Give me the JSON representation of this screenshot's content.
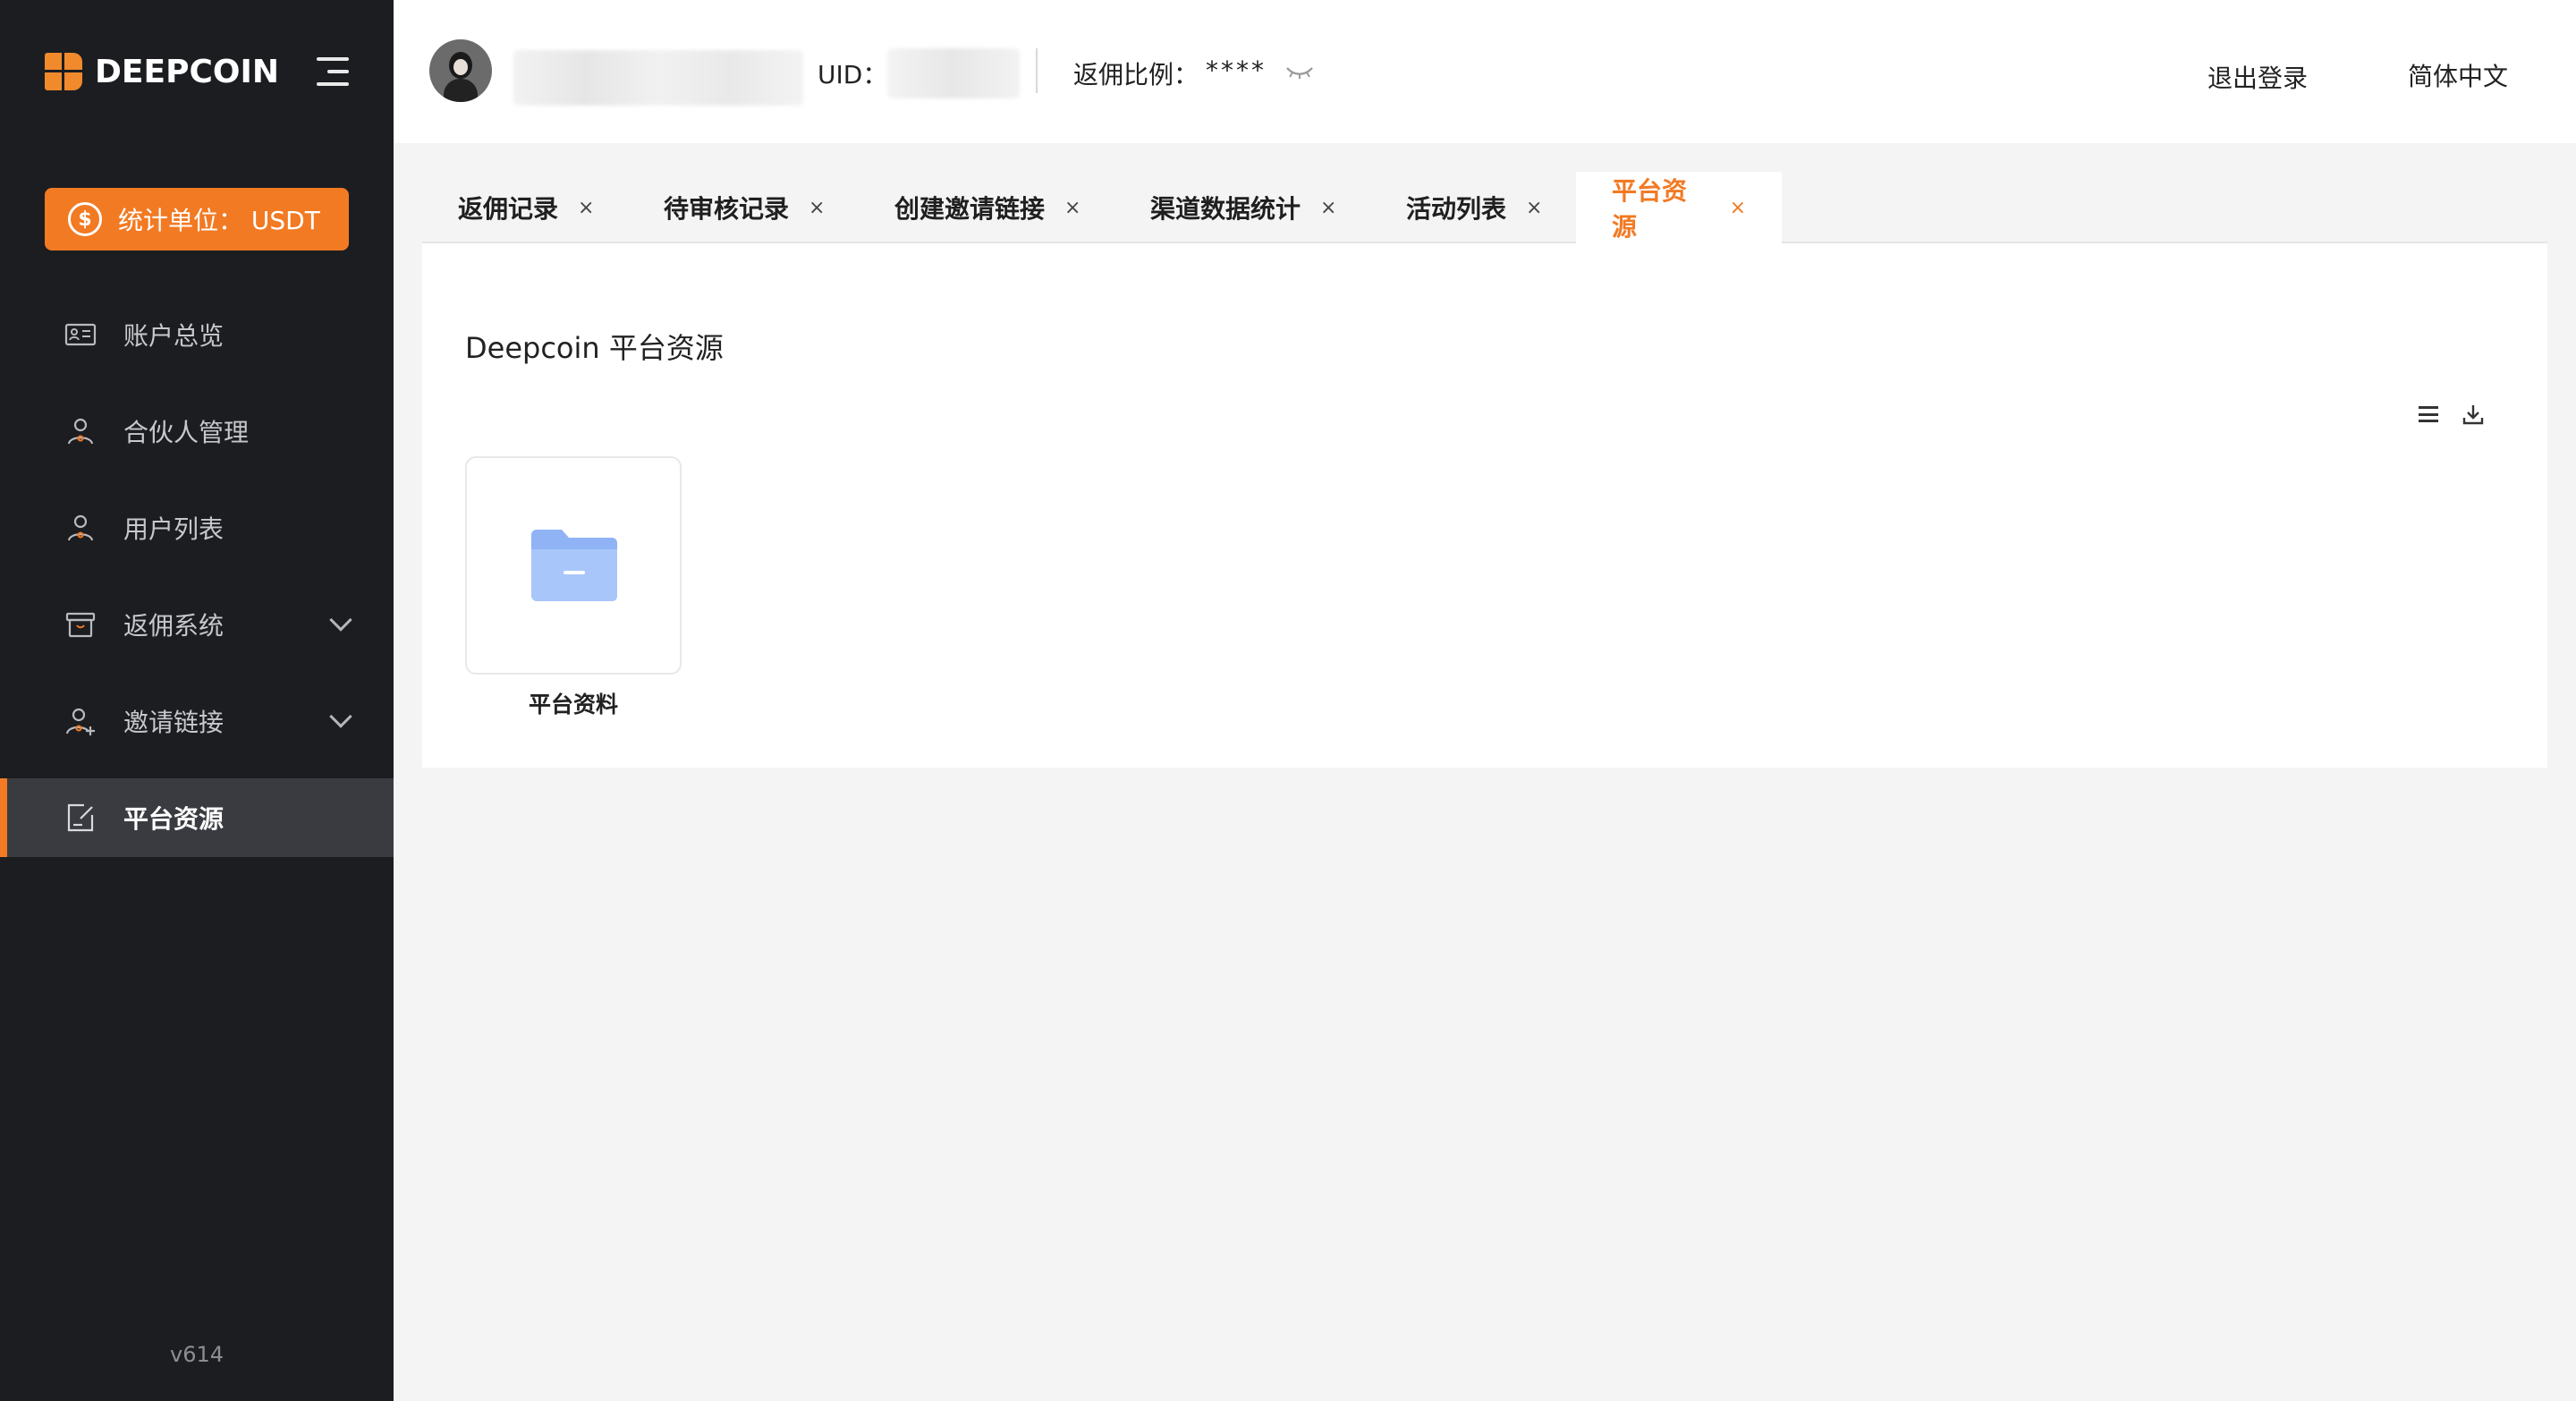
{
  "brand": {
    "name": "DEEPCOIN",
    "accent": "#f27a23"
  },
  "sidebar": {
    "unit_button": "统计单位：  USDT",
    "items": [
      {
        "label": "账户总览",
        "icon": "id-card-icon"
      },
      {
        "label": "合伙人管理",
        "icon": "partner-icon"
      },
      {
        "label": "用户列表",
        "icon": "user-icon"
      },
      {
        "label": "返佣系统",
        "icon": "gift-box-icon",
        "has_submenu": true
      },
      {
        "label": "邀请链接",
        "icon": "user-add-icon",
        "has_submenu": true
      },
      {
        "label": "平台资源",
        "icon": "edit-doc-icon",
        "active": true
      }
    ],
    "version": "v614"
  },
  "header": {
    "uid_label": "UID：",
    "uid_value_partial": ":",
    "ratio_label": "返佣比例：",
    "ratio_value": "****",
    "logout": "退出登录",
    "language": "简体中文"
  },
  "tabs": [
    {
      "label": "返佣记录",
      "close": "×"
    },
    {
      "label": "待审核记录",
      "close": "×"
    },
    {
      "label": "创建邀请链接",
      "close": "×"
    },
    {
      "label": "渠道数据统计",
      "close": "×"
    },
    {
      "label": "活动列表",
      "close": "×"
    },
    {
      "label": "平台资源",
      "close": "×",
      "active": true
    }
  ],
  "main": {
    "title": "Deepcoin 平台资源",
    "folders": [
      {
        "label": "平台资料"
      }
    ]
  }
}
